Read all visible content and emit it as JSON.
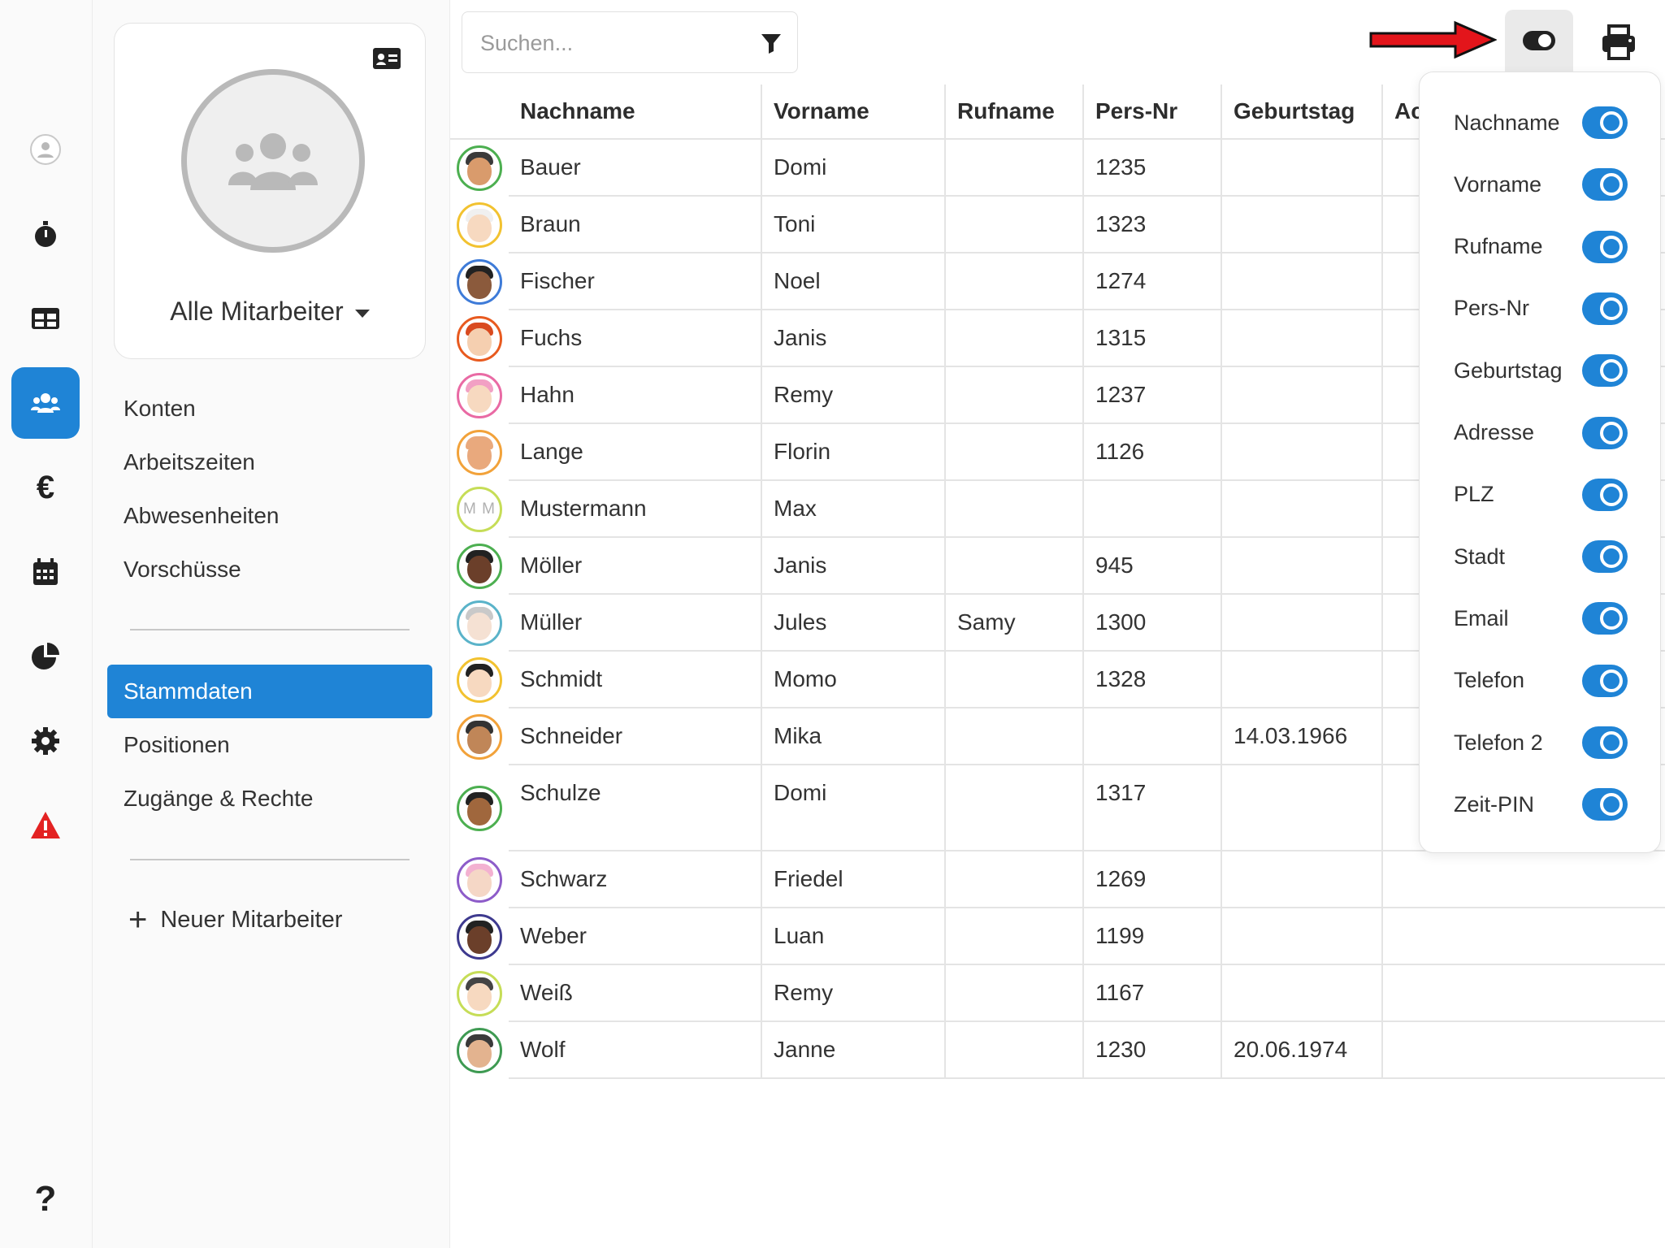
{
  "sidebar_rail": {
    "items": [
      {
        "icon": "user-circle-icon"
      },
      {
        "icon": "stopwatch-icon"
      },
      {
        "icon": "table-icon"
      },
      {
        "icon": "users-icon",
        "active": true
      },
      {
        "icon": "euro-icon",
        "glyph": "€"
      },
      {
        "icon": "calendar-icon"
      },
      {
        "icon": "pie-chart-icon"
      },
      {
        "icon": "gear-icon"
      },
      {
        "icon": "warning-icon"
      },
      {
        "icon": "help-icon",
        "glyph": "?"
      }
    ]
  },
  "profile": {
    "group_label": "Alle Mitarbeiter"
  },
  "menu": {
    "section1": [
      "Konten",
      "Arbeitszeiten",
      "Abwesenheiten",
      "Vorschüsse"
    ],
    "section2": [
      "Stammdaten",
      "Positionen",
      "Zugänge & Rechte"
    ],
    "active": "Stammdaten",
    "new_employee": "Neuer Mitarbeiter"
  },
  "search": {
    "placeholder": "Suchen..."
  },
  "table": {
    "columns": [
      "Nachname",
      "Vorname",
      "Rufname",
      "Pers-Nr",
      "Geburtstag",
      "Ac"
    ],
    "rows": [
      {
        "nachname": "Bauer",
        "vorname": "Domi",
        "rufname": "",
        "persnr": "1235",
        "geburtstag": ""
      },
      {
        "nachname": "Braun",
        "vorname": "Toni",
        "rufname": "",
        "persnr": "1323",
        "geburtstag": ""
      },
      {
        "nachname": "Fischer",
        "vorname": "Noel",
        "rufname": "",
        "persnr": "1274",
        "geburtstag": ""
      },
      {
        "nachname": "Fuchs",
        "vorname": "Janis",
        "rufname": "",
        "persnr": "1315",
        "geburtstag": ""
      },
      {
        "nachname": "Hahn",
        "vorname": "Remy",
        "rufname": "",
        "persnr": "1237",
        "geburtstag": ""
      },
      {
        "nachname": "Lange",
        "vorname": "Florin",
        "rufname": "",
        "persnr": "1126",
        "geburtstag": ""
      },
      {
        "nachname": "Mustermann",
        "vorname": "Max",
        "rufname": "",
        "persnr": "",
        "geburtstag": "",
        "initials": "M M"
      },
      {
        "nachname": "Möller",
        "vorname": "Janis",
        "rufname": "",
        "persnr": "945",
        "geburtstag": ""
      },
      {
        "nachname": "Müller",
        "vorname": "Jules",
        "rufname": "Samy",
        "persnr": "1300",
        "geburtstag": ""
      },
      {
        "nachname": "Schmidt",
        "vorname": "Momo",
        "rufname": "",
        "persnr": "1328",
        "geburtstag": ""
      },
      {
        "nachname": "Schneider",
        "vorname": "Mika",
        "rufname": "",
        "persnr": "",
        "geburtstag": "14.03.1966"
      },
      {
        "nachname": "Schulze",
        "vorname": "Domi",
        "rufname": "",
        "persnr": "1317",
        "geburtstag": ""
      },
      {
        "nachname": "Schwarz",
        "vorname": "Friedel",
        "rufname": "",
        "persnr": "1269",
        "geburtstag": ""
      },
      {
        "nachname": "Weber",
        "vorname": "Luan",
        "rufname": "",
        "persnr": "1199",
        "geburtstag": ""
      },
      {
        "nachname": "Weiß",
        "vorname": "Remy",
        "rufname": "",
        "persnr": "1167",
        "geburtstag": ""
      },
      {
        "nachname": "Wolf",
        "vorname": "Janne",
        "rufname": "",
        "persnr": "1230",
        "geburtstag": "20.06.1974"
      }
    ]
  },
  "column_toggles": {
    "items": [
      {
        "label": "Nachname",
        "on": true
      },
      {
        "label": "Vorname",
        "on": true
      },
      {
        "label": "Rufname",
        "on": true
      },
      {
        "label": "Pers-Nr",
        "on": true
      },
      {
        "label": "Geburtstag",
        "on": true
      },
      {
        "label": "Adresse",
        "on": true
      },
      {
        "label": "PLZ",
        "on": true
      },
      {
        "label": "Stadt",
        "on": true
      },
      {
        "label": "Email",
        "on": true
      },
      {
        "label": "Telefon",
        "on": true
      },
      {
        "label": "Telefon 2",
        "on": true
      },
      {
        "label": "Zeit-PIN",
        "on": true
      }
    ]
  },
  "colors": {
    "accent": "#1f84d6",
    "arrow": "#e3151b"
  }
}
